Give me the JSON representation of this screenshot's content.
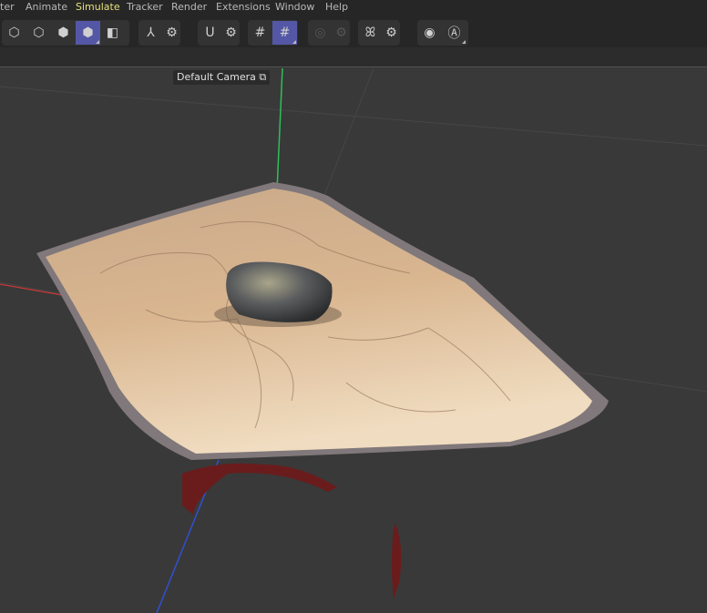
{
  "menu": [
    {
      "label": "ter"
    },
    {
      "label": "Animate"
    },
    {
      "label": "Simulate",
      "highlighted": true
    },
    {
      "label": "Tracker"
    },
    {
      "label": "Render"
    },
    {
      "label": "Extensions"
    },
    {
      "label": "Window"
    },
    {
      "label": "Help"
    }
  ],
  "toolbar": {
    "icons": [
      "points-mode-icon",
      "edges-mode-icon",
      "polygons-mode-icon",
      "model-mode-icon",
      "texture-mode-icon",
      "axis-icon",
      "axis-settings-icon",
      "snap-magnet-icon",
      "snap-settings-icon",
      "grid-workplane-icon",
      "locked-workplane-icon",
      "symmetry-icon",
      "symmetry-settings-icon",
      "mirror-icon",
      "mirror-settings-icon",
      "view-icon",
      "auto-key-icon"
    ]
  },
  "viewport": {
    "camera_label": "Default Camera",
    "colors": {
      "accent": "#5457a6",
      "y_axis": "#2fbf5a",
      "x_axis": "#c83838",
      "z_axis": "#3050d0"
    }
  }
}
